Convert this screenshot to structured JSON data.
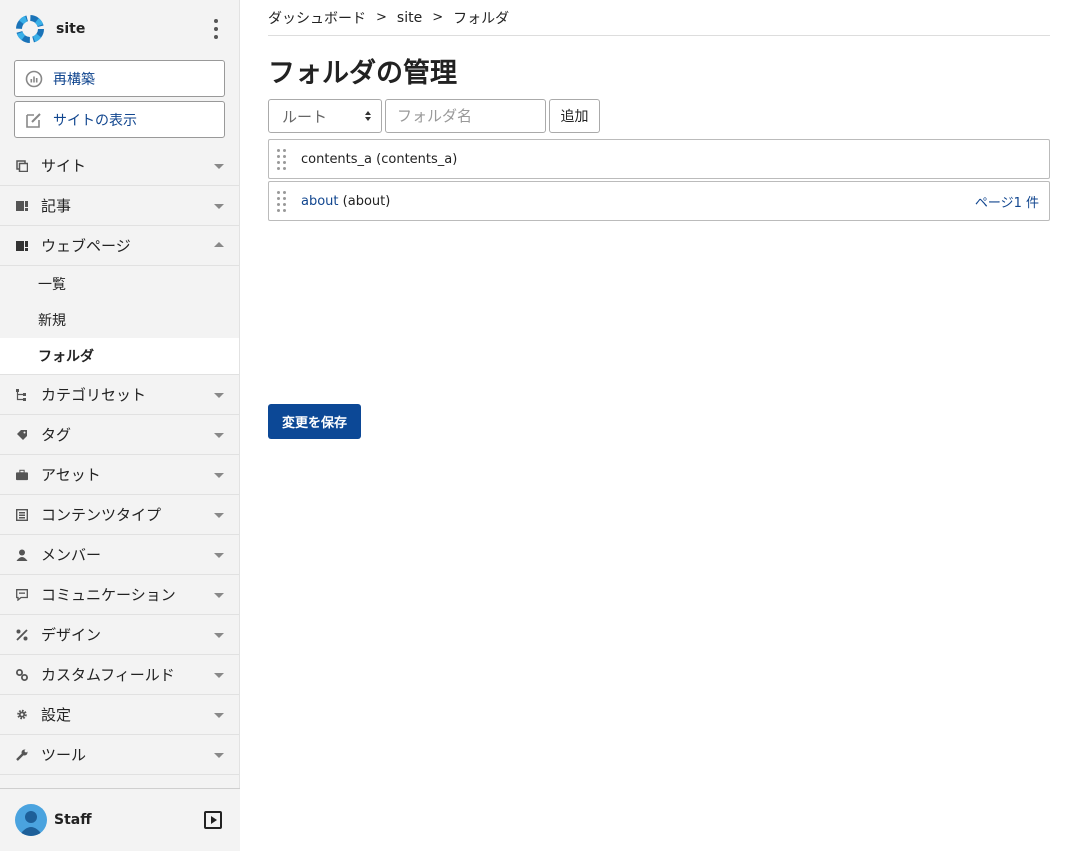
{
  "sidebar": {
    "site_name": "site",
    "rebuild_label": "再構築",
    "view_site_label": "サイトの表示",
    "menu": [
      {
        "label": "サイト",
        "icon": "site-icon"
      },
      {
        "label": "記事",
        "icon": "entry-icon"
      },
      {
        "label": "ウェブページ",
        "icon": "webpage-icon"
      },
      {
        "label": "カテゴリセット",
        "icon": "category-set-icon"
      },
      {
        "label": "タグ",
        "icon": "tag-icon"
      },
      {
        "label": "アセット",
        "icon": "asset-icon"
      },
      {
        "label": "コンテンツタイプ",
        "icon": "content-type-icon"
      },
      {
        "label": "メンバー",
        "icon": "member-icon"
      },
      {
        "label": "コミュニケーション",
        "icon": "communication-icon"
      },
      {
        "label": "デザイン",
        "icon": "design-icon"
      },
      {
        "label": "カスタムフィールド",
        "icon": "custom-field-icon"
      },
      {
        "label": "設定",
        "icon": "settings-icon"
      },
      {
        "label": "ツール",
        "icon": "tool-icon"
      }
    ],
    "webpage_submenu": [
      "一覧",
      "新規",
      "フォルダ"
    ],
    "user_name": "Staff"
  },
  "breadcrumb": [
    "ダッシュボード",
    "site",
    "フォルダ"
  ],
  "breadcrumb_sep": ">",
  "page_title": "フォルダの管理",
  "controls": {
    "parent_select": "ルート",
    "folder_name_placeholder": "フォルダ名",
    "add_label": "追加"
  },
  "folders": [
    {
      "label": "contents_a",
      "basename": "(contents_a)",
      "count": ""
    },
    {
      "label": "about",
      "basename": "(about)",
      "count": "ページ1 件"
    }
  ],
  "save_label": "変更を保存",
  "colors": {
    "accent": "#0c4896",
    "link": "#11468f",
    "sidebar_bg": "#f3f3f3"
  }
}
